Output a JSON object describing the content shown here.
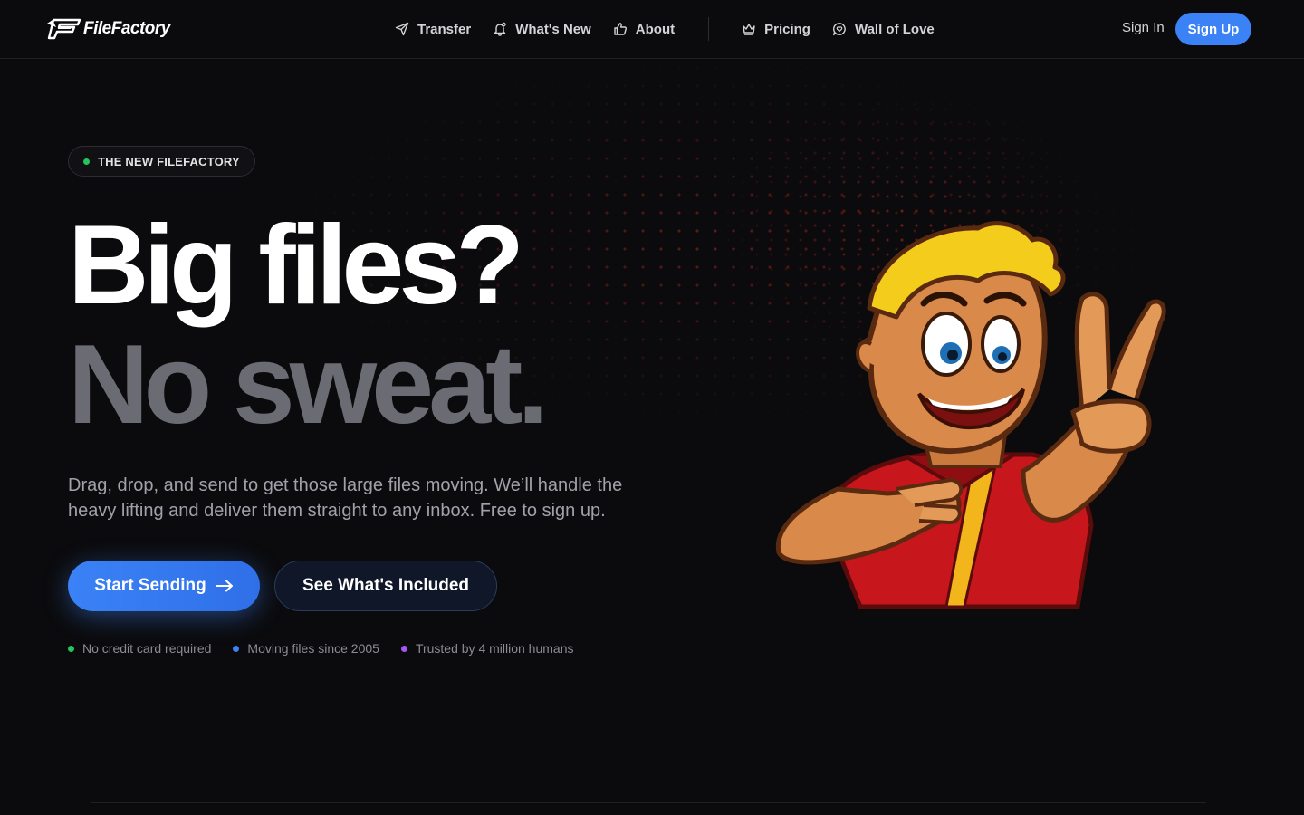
{
  "header": {
    "logo_text": "FileFactory",
    "nav": [
      {
        "label": "Transfer",
        "icon": "send-icon"
      },
      {
        "label": "What's New",
        "icon": "bell-icon"
      },
      {
        "label": "About",
        "icon": "thumbs-up-icon"
      },
      {
        "label": "Pricing",
        "icon": "crown-icon"
      },
      {
        "label": "Wall of Love",
        "icon": "message-heart-icon"
      }
    ],
    "sign_in": "Sign In",
    "sign_up": "Sign Up"
  },
  "hero": {
    "badge": "THE NEW FILEFACTORY",
    "headline_line1": "Big files?",
    "headline_line2": "No sweat.",
    "description": "Drag, drop, and send to get those large files moving. We’ll handle the heavy lifting and deliver them straight to any inbox. Free to sign up.",
    "primary_cta": "Start Sending",
    "secondary_cta": "See What's Included",
    "features": [
      {
        "label": "No credit card required",
        "color": "#22c55e"
      },
      {
        "label": "Moving files since 2005",
        "color": "#3b82f6"
      },
      {
        "label": "Trusted by 4 million humans",
        "color": "#a855f7"
      }
    ]
  },
  "colors": {
    "background": "#0b0b0d",
    "accent": "#3b82f6",
    "headline_muted": "#6b6b73"
  }
}
